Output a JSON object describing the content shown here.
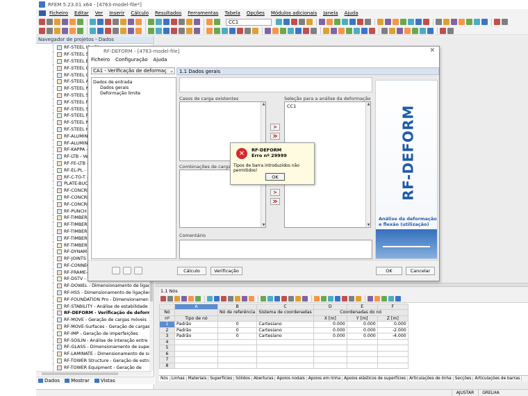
{
  "window": {
    "title": "RFEM 5.23.01 x64 - [4763-model-file*]"
  },
  "menubar": [
    "Ficheiro",
    "Editar",
    "Ver",
    "Inserir",
    "Cálculo",
    "Resultados",
    "Ferramentas",
    "Tabela",
    "Opções",
    "Módulos adicionais",
    "Janela",
    "Ajuda"
  ],
  "toolbar": {
    "load_case": "CC1"
  },
  "navigator": {
    "title": "Navegador de projetos - Dados",
    "items": [
      "RF-STEEL IS - Dime",
      "RF-STEEL SIA - Dime",
      "RF-STEEL BS - Dime",
      "RF-STEEL GB - Dime",
      "RF-STEEL CSA - Dim",
      "RF-STEEL AS - Dime",
      "RF-STEEL NTC-DF -",
      "RF-STEEL SP - Dime",
      "RF-STEEL Plastic - C",
      "RF-STEEL SANS - Di",
      "RF-STEEL Fatigue M",
      "RF-STEEL NBR - Di",
      "RF-STEEL HK - Dim",
      "RF-ALUMINUM - D",
      "RF-ALUMINUM AD",
      "RF-KAPPA - Verific",
      "RF-LTB - Verificaç",
      "RF-FE-LTB - Verifica",
      "RF-EL-PL - Dimensi",
      "RF-C-TO-T - Verific",
      "PLATE-BUCKLING -",
      "RF-CONCRETE Surf",
      "RF-CONCRETE Mer",
      "RF-CONCRETE Colu",
      "RF-PUNCH Pro - Ve",
      "RF-TIMBER Pro - Di",
      "RF-TIMBER AWC -",
      "RF-TIMBER CSA - D",
      "RF-TIMBER NBR - D",
      "RF-TIMBER SANS -",
      "RF-DYNAM Pro - A",
      "RF-JOINTS - Dimen",
      "RF-CONNECT - Dim",
      "RF-FRAME-JOINT P",
      "RF-DSTV - Dimensionamento de ligações",
      "RF-DOWEL - Dimensionamento de ligaç",
      "RF-HSS - Dimensionamento de ligações",
      "RF-FOUNDATION Pro - Dimensionamen",
      "RF-STABILITY - Análise de estabilidade",
      "RF-DEFORM - Verificação de deformaç",
      "RF-MOVE - Geração de cargas móveis",
      "RF-MOVE-Surfaces - Geração de cargas",
      "RF-IMP - Geração de imperfeições",
      "RF-SOILIN - Análise de interação entre sc",
      "RF-GLASS - Dimensionamento de superf",
      "RF-LAMINATE - Dimensionamento de su",
      "RF-TOWER Structure - Geração de estrut",
      "RF-TOWER Equipment - Geração de"
    ],
    "bold_item": "RF-DEFORM - Verificação de deformaç",
    "tabs": [
      "Dados",
      "Mostrar",
      "Vistas"
    ]
  },
  "dialog": {
    "title": "RF-DEFORM - [4763-model-file]",
    "menu": [
      "Ficheiro",
      "Configuração",
      "Ajuda"
    ],
    "case_select": "CA1 - Verificação de deformaç",
    "tree_root": "Dados de entrada",
    "tree_children": [
      "Dados gerais",
      "Deformação limite"
    ],
    "section_header": "1.1 Dados gerais",
    "existing_cases_label": "Casos de carga existentes",
    "selected_label": "Seleção para a análise da deformação",
    "selected_items": [
      "CC1"
    ],
    "combos_label": "Combinações de cargas e co",
    "comment_label": "Comentário",
    "arrow_add": ">",
    "arrow_add_all": "≫",
    "brand_title": "RF-DEFORM",
    "brand_subtitle": "Análise da deformação e flexão (utilização)",
    "buttons": {
      "calc": "Cálculo",
      "check": "Verificação",
      "ok": "OK",
      "cancel": "Cancelar"
    }
  },
  "message": {
    "title": "RF-DEFORM",
    "error": "Erro nº 29999",
    "text": "Tipos de barra introduzidos não permitidos!",
    "ok": "OK"
  },
  "nodes_table": {
    "title": "1.1 Nós",
    "col_letters": [
      "A",
      "B",
      "C",
      "D",
      "E",
      "F"
    ],
    "header_no": [
      "Nó",
      "nº"
    ],
    "headers": [
      "Tipo de nó",
      "Nó de referência",
      "Sistema de coordenadas",
      "X [m]",
      "Y [m]",
      "Z [m]"
    ],
    "coord_group": "Coordenadas do nó",
    "rows": [
      {
        "no": "1",
        "type": "Padrão",
        "ref": "0",
        "sys": "Cartesiano",
        "x": "0.000",
        "y": "0.000",
        "z": "0.000"
      },
      {
        "no": "2",
        "type": "Padrão",
        "ref": "0",
        "sys": "Cartesiano",
        "x": "0.000",
        "y": "0.000",
        "z": "-2.000"
      },
      {
        "no": "3",
        "type": "Padrão",
        "ref": "0",
        "sys": "Cartesiano",
        "x": "0.000",
        "y": "0.000",
        "z": "-4.000"
      },
      {
        "no": "4",
        "type": "",
        "ref": "",
        "sys": "",
        "x": "",
        "y": "",
        "z": ""
      },
      {
        "no": "5",
        "type": "",
        "ref": "",
        "sys": "",
        "x": "",
        "y": "",
        "z": ""
      },
      {
        "no": "6",
        "type": "",
        "ref": "",
        "sys": "",
        "x": "",
        "y": "",
        "z": ""
      },
      {
        "no": "7",
        "type": "",
        "ref": "",
        "sys": "",
        "x": "",
        "y": "",
        "z": ""
      },
      {
        "no": "8",
        "type": "",
        "ref": "",
        "sys": "",
        "x": "",
        "y": "",
        "z": ""
      }
    ]
  },
  "bottom_tabs": [
    "Nós",
    "Linhas",
    "Materiais",
    "Superfícies",
    "Sólidos",
    "Aberturas",
    "Apoios nodais",
    "Apoios em linha",
    "Apoios elásticos de superfícies",
    "Articulações de linha",
    "Secções",
    "Articulações de barras"
  ],
  "status": [
    "AJUSTAR",
    "GRELHA"
  ]
}
